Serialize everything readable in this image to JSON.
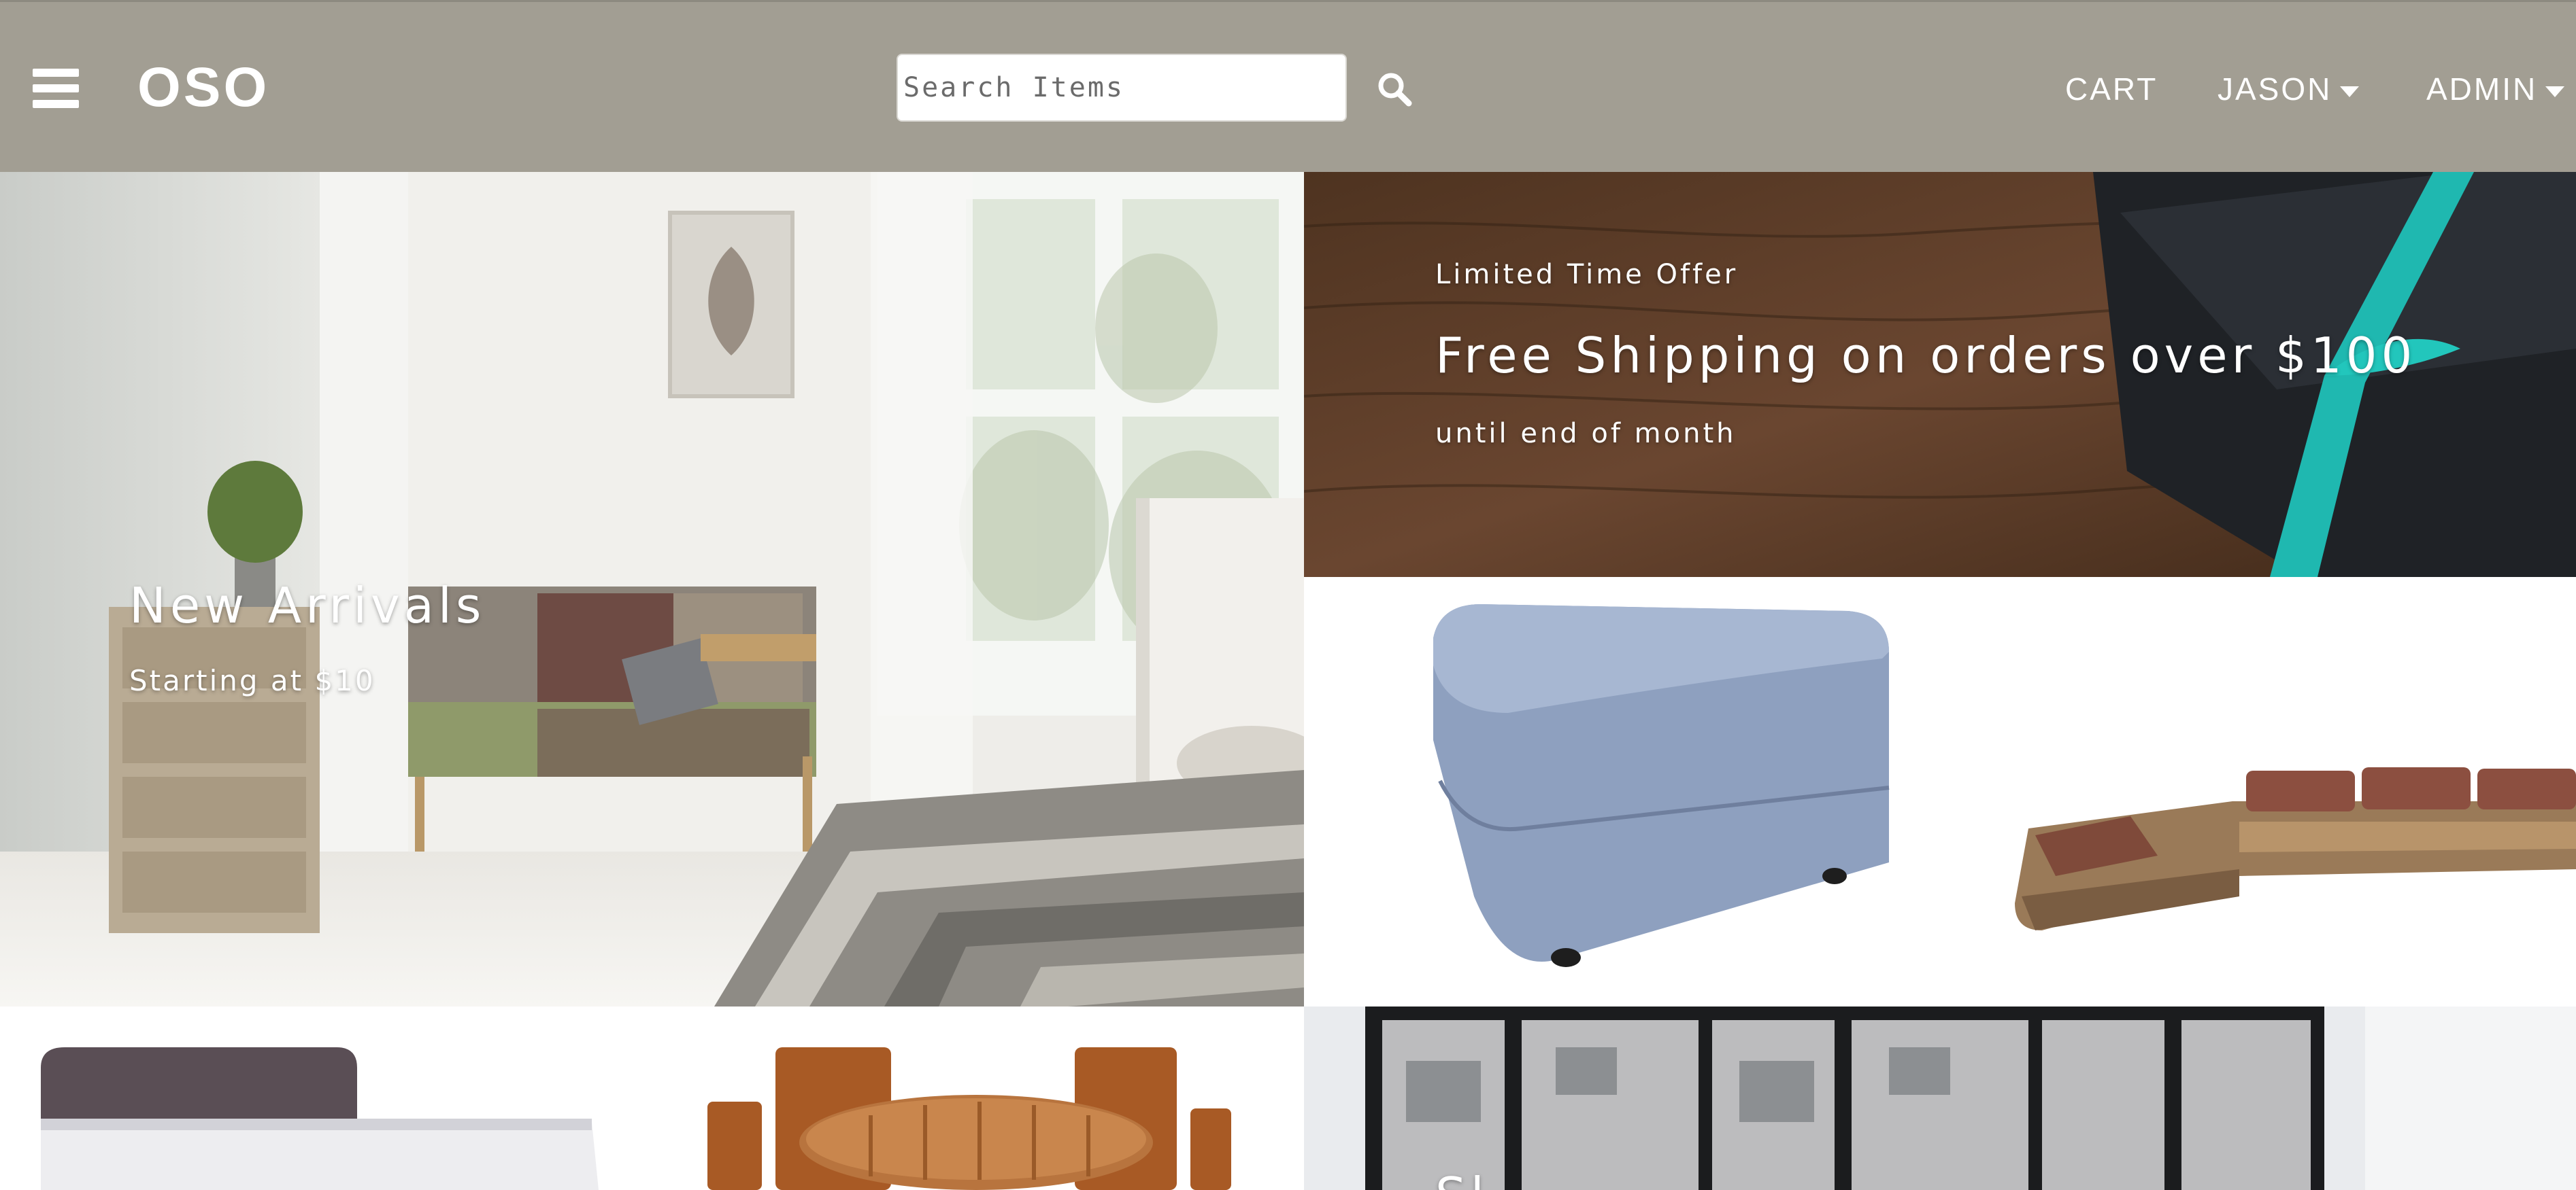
{
  "header": {
    "menu_icon": "hamburger-menu-icon",
    "logo": "OSO",
    "search": {
      "placeholder": "Search Items",
      "value": "",
      "icon": "search-icon"
    },
    "nav": {
      "cart": "CART",
      "user": "JASON",
      "admin": "ADMIN"
    }
  },
  "promo": {
    "new_arrivals": {
      "title": "New Arrivals",
      "subtitle": "Starting at $10"
    },
    "shipping": {
      "eyebrow": "Limited Time Offer",
      "title": "Free Shipping on orders over $100",
      "subtitle": "until end of month"
    },
    "bottom_right": {
      "title": "Sl"
    }
  },
  "colors": {
    "navbar": "#a29e93",
    "text_on_dark": "#ffffff",
    "ribbon": "#1fb8b0"
  }
}
